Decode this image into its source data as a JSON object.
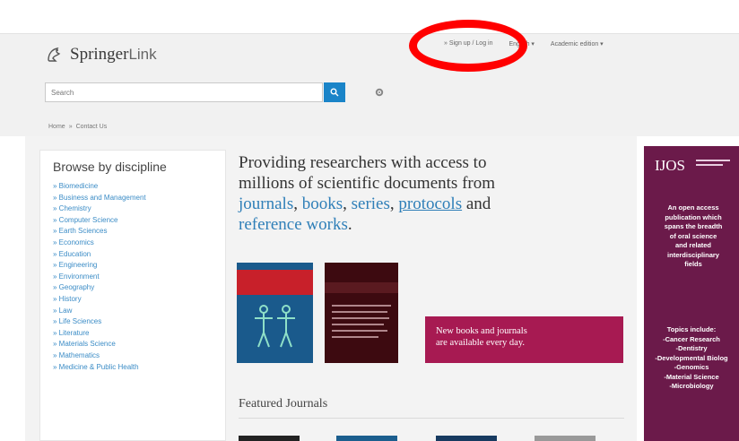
{
  "brand": {
    "name": "Springer",
    "name_light": "Link"
  },
  "topnav": {
    "sign_up": "» Sign up / Log in",
    "language": "English ▾",
    "academic": "Academic edition ▾"
  },
  "search": {
    "placeholder": "Search"
  },
  "breadcrumb": {
    "home": "Home",
    "sep": "»",
    "contact": "Contact Us"
  },
  "sidebar": {
    "title": "Browse by discipline",
    "items": [
      "» Biomedicine",
      "» Business and Management",
      "» Chemistry",
      "» Computer Science",
      "» Earth Sciences",
      "» Economics",
      "» Education",
      "» Engineering",
      "» Environment",
      "» Geography",
      "» History",
      "» Law",
      "» Life Sciences",
      "» Literature",
      "» Materials Science",
      "» Mathematics",
      "» Medicine & Public Health"
    ]
  },
  "hero": {
    "line1": "Providing researchers with access to",
    "line2": "millions of scientific documents from",
    "journals": "journals",
    "comma1": ", ",
    "books": "books",
    "comma2": ", ",
    "series": "series",
    "comma3": ", ",
    "protocols": "protocols",
    "and": " and",
    "reference": "reference works",
    "period": "."
  },
  "promo": {
    "line1": "New books and journals",
    "line2": "are available every day."
  },
  "featured": {
    "title": "Featured Journals"
  },
  "ad": {
    "brand": "IJOS",
    "description": [
      "An open access",
      "publication which",
      "spans the breadth",
      "of oral science",
      "and related",
      "interdisciplinary",
      "fields"
    ],
    "topics_title": "Topics include:",
    "topics": [
      "-Cancer Research",
      "-Dentistry",
      "-Developmental Biolog",
      "-Genomics",
      "-Material Science",
      "-Microbiology"
    ]
  },
  "colors": {
    "accent": "#1a84c8",
    "link": "#3b8cc6",
    "promo": "#a71a52",
    "ad": "#6b1a4a",
    "highlight": "#ff0000"
  }
}
